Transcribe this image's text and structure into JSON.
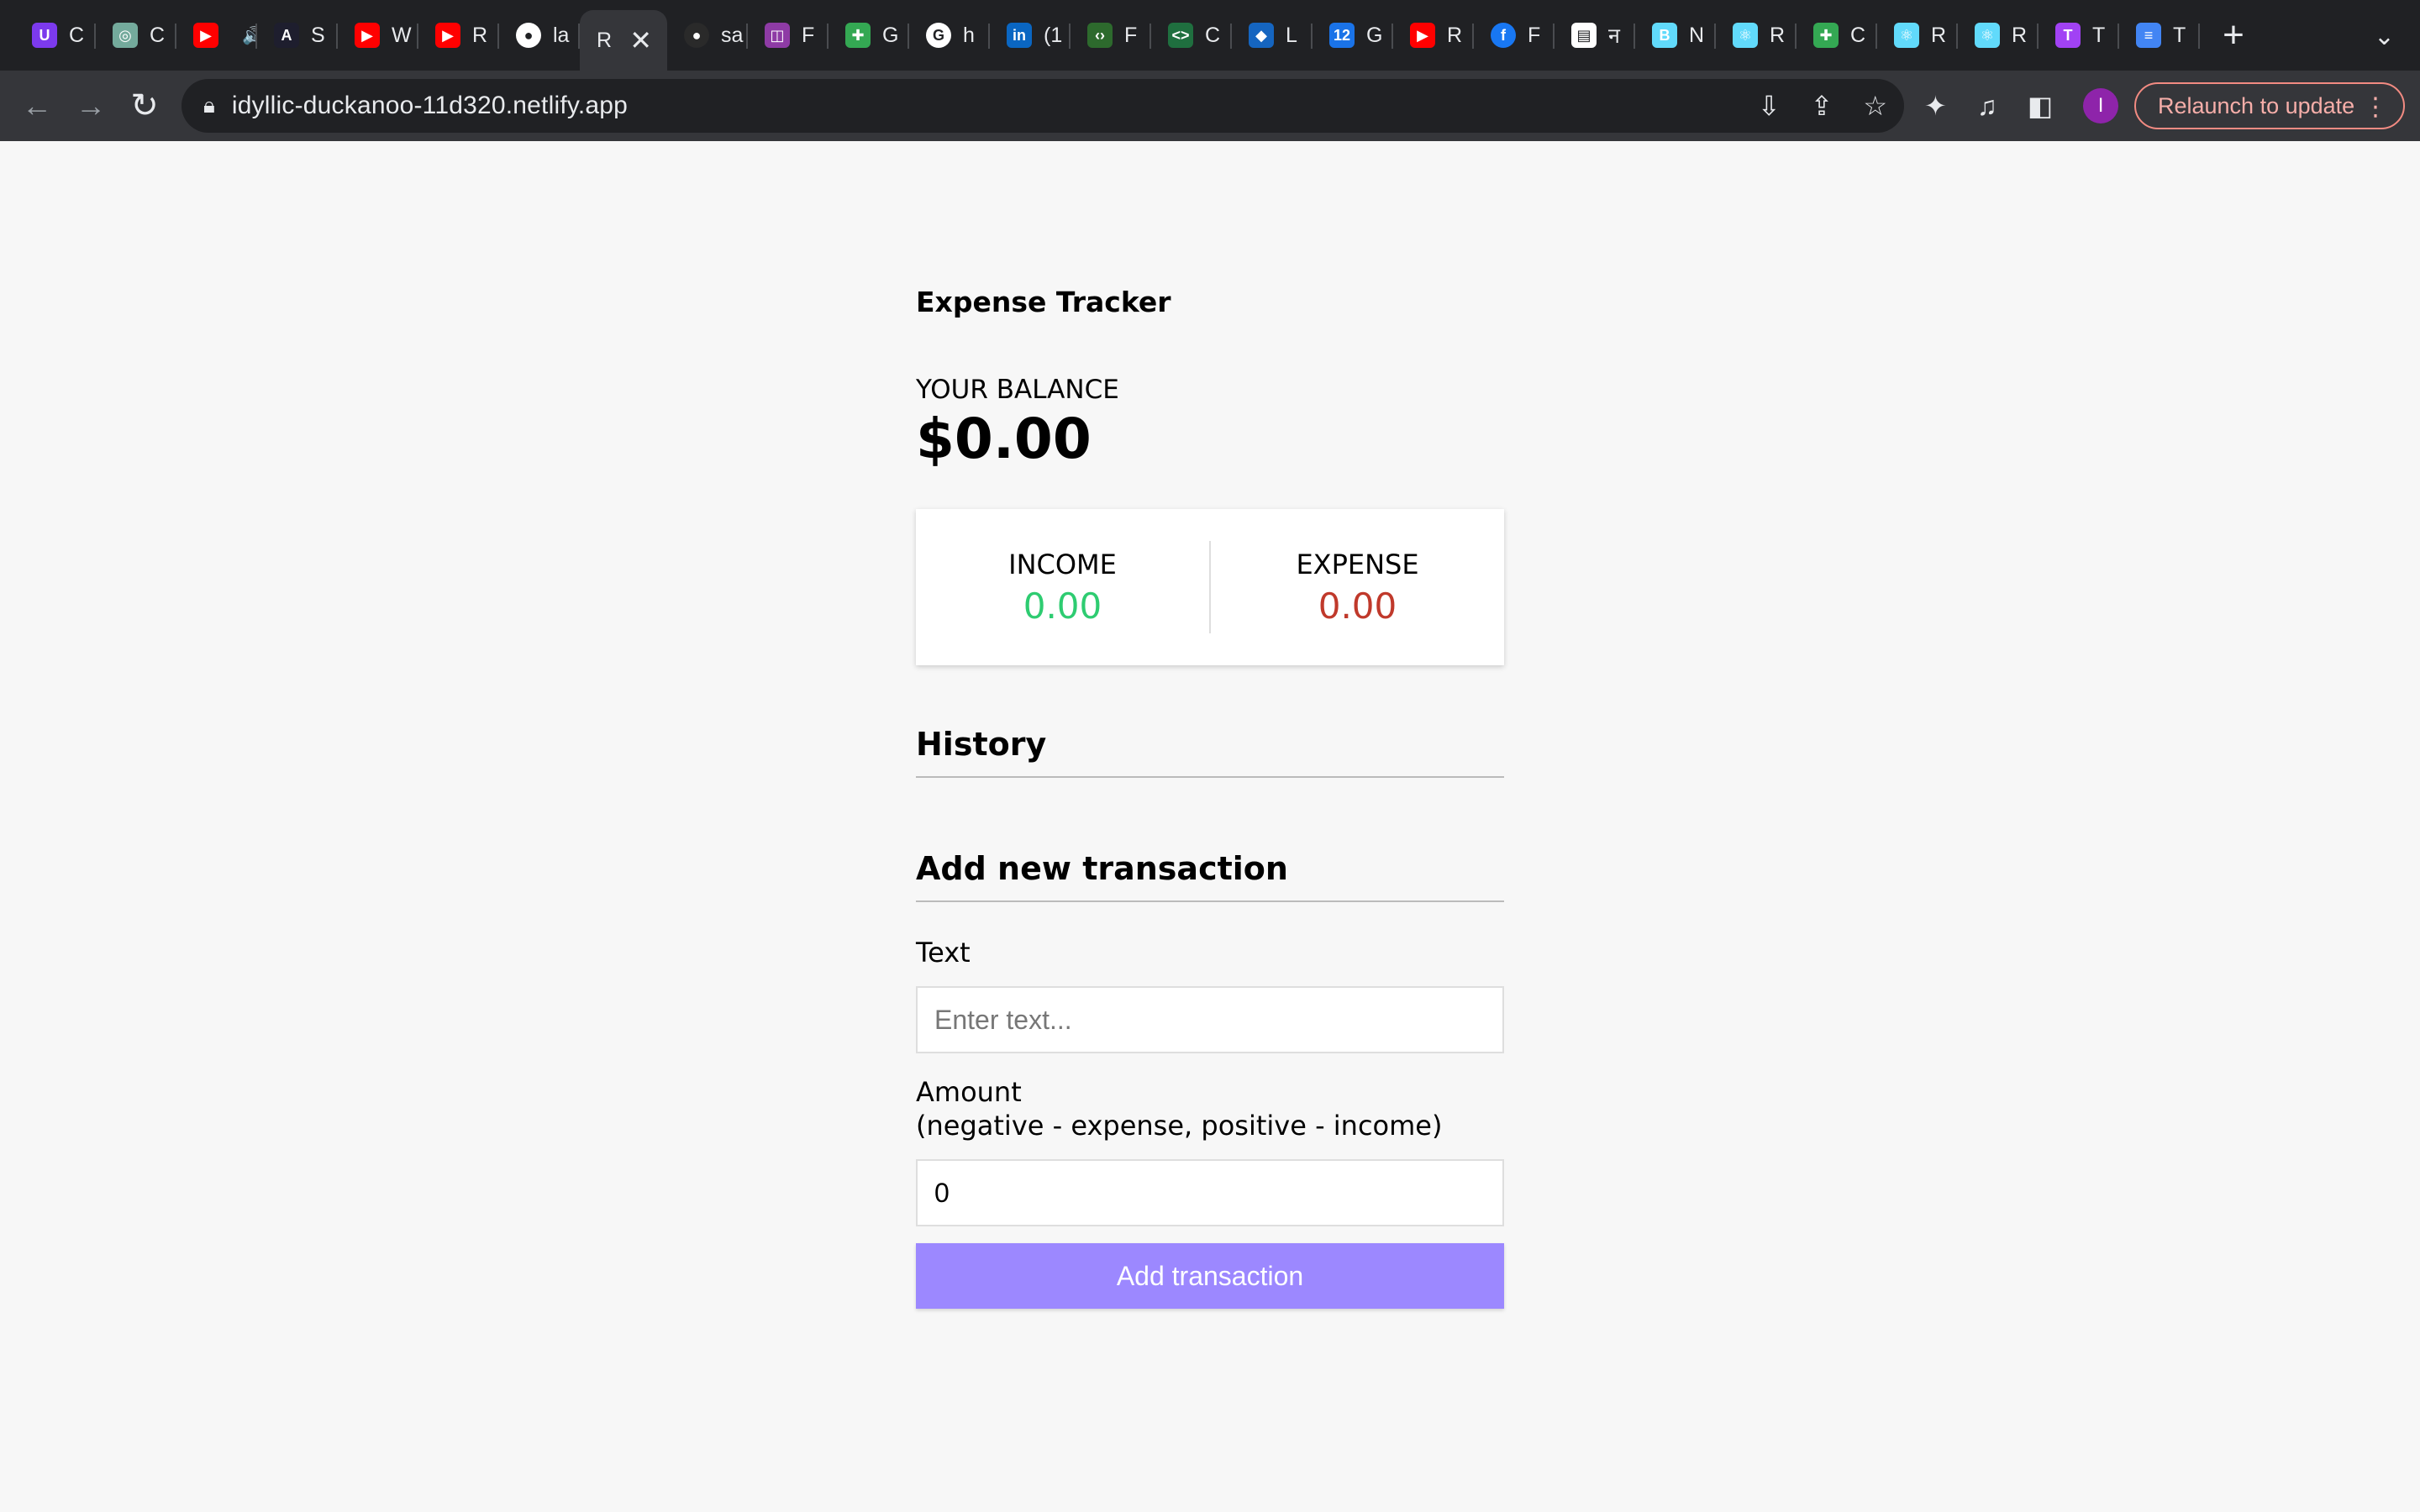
{
  "browser": {
    "tabs": [
      {
        "title": "C",
        "icon": "shield-u-icon",
        "color": "#7c3aed",
        "glyph": "U"
      },
      {
        "title": "C",
        "icon": "chatgpt-icon",
        "color": "#74aa9c",
        "glyph": "◎"
      },
      {
        "title": "",
        "icon": "youtube-icon",
        "color": "#ff0000",
        "glyph": "▶",
        "extra": "🔊"
      },
      {
        "title": "S",
        "icon": "angular-a-icon",
        "color": "#1e1e2e",
        "glyph": "A"
      },
      {
        "title": "W",
        "icon": "youtube-icon",
        "color": "#ff0000",
        "glyph": "▶"
      },
      {
        "title": "R",
        "icon": "youtube-icon",
        "color": "#ff0000",
        "glyph": "▶"
      },
      {
        "title": "la",
        "icon": "github-icon",
        "color": "#ffffff",
        "glyph": "●"
      },
      {
        "title": "R",
        "icon": "",
        "color": "",
        "glyph": "",
        "active": true
      },
      {
        "title": "sa",
        "icon": "github-dark-icon",
        "color": "#2a2a2a",
        "glyph": "●"
      },
      {
        "title": "F",
        "icon": "figma-plugin-icon",
        "color": "#8e3ba5",
        "glyph": "◫"
      },
      {
        "title": "G",
        "icon": "sheets-icon",
        "color": "#34a853",
        "glyph": "✚"
      },
      {
        "title": "h",
        "icon": "google-icon",
        "color": "#ffffff",
        "glyph": "G"
      },
      {
        "title": "(1",
        "icon": "linkedin-icon",
        "color": "#0a66c2",
        "glyph": "in"
      },
      {
        "title": "F",
        "icon": "code-arrows-icon",
        "color": "#2d6a2d",
        "glyph": "‹›"
      },
      {
        "title": "C",
        "icon": "code-icon",
        "color": "#1f6f3f",
        "glyph": "<>"
      },
      {
        "title": "L",
        "icon": "diamond-icon",
        "color": "#1565c0",
        "glyph": "◆"
      },
      {
        "title": "G",
        "icon": "calendar-icon",
        "color": "#1a73e8",
        "glyph": "12"
      },
      {
        "title": "R",
        "icon": "youtube-icon",
        "color": "#ff0000",
        "glyph": "▶"
      },
      {
        "title": "F",
        "icon": "facebook-icon",
        "color": "#1877f2",
        "glyph": "f"
      },
      {
        "title": "न",
        "icon": "news-icon",
        "color": "#ffffff",
        "glyph": "▤"
      },
      {
        "title": "N",
        "icon": "bootstrap-icon",
        "color": "#61dafb",
        "glyph": "B"
      },
      {
        "title": "R",
        "icon": "react-icon",
        "color": "#61dafb",
        "glyph": "⚛"
      },
      {
        "title": "C",
        "icon": "sheets-icon",
        "color": "#34a853",
        "glyph": "✚"
      },
      {
        "title": "R",
        "icon": "react-icon",
        "color": "#61dafb",
        "glyph": "⚛"
      },
      {
        "title": "R",
        "icon": "react-icon",
        "color": "#61dafb",
        "glyph": "⚛"
      },
      {
        "title": "T",
        "icon": "t-icon",
        "color": "#a142f4",
        "glyph": "T"
      },
      {
        "title": "T",
        "icon": "docs-icon",
        "color": "#4285f4",
        "glyph": "≡"
      }
    ],
    "url": "idyllic-duckanoo-11d320.netlify.app",
    "relaunch_label": "Relaunch to update",
    "avatar_letter": "I"
  },
  "app": {
    "title": "Expense Tracker",
    "balance_label": "YOUR BALANCE",
    "balance_value": "$0.00",
    "income_label": "INCOME",
    "income_value": "0.00",
    "expense_label": "EXPENSE",
    "expense_value": "0.00",
    "history_heading": "History",
    "add_heading": "Add new transaction",
    "text_label": "Text",
    "text_placeholder": "Enter text...",
    "text_value": "",
    "amount_label_line1": "Amount",
    "amount_label_line2": "(negative - expense, positive - income)",
    "amount_value": "0",
    "submit_label": "Add transaction"
  }
}
